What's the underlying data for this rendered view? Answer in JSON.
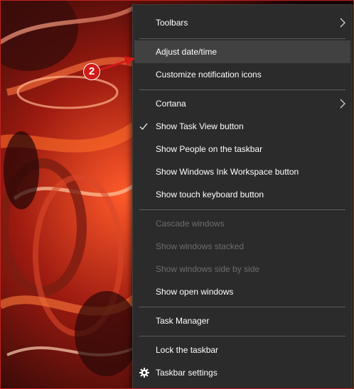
{
  "callout": {
    "number": "2"
  },
  "menu": {
    "toolbars": "Toolbars",
    "adjust_datetime": "Adjust date/time",
    "customize_notifications": "Customize notification icons",
    "cortana": "Cortana",
    "show_task_view": "Show Task View button",
    "show_task_view_checked": true,
    "show_people": "Show People on the taskbar",
    "show_ink": "Show Windows Ink Workspace button",
    "show_touch_keyboard": "Show touch keyboard button",
    "cascade": "Cascade windows",
    "stacked": "Show windows stacked",
    "side_by_side": "Show windows side by side",
    "show_open_windows": "Show open windows",
    "task_manager": "Task Manager",
    "lock_taskbar": "Lock the taskbar",
    "taskbar_settings": "Taskbar settings"
  },
  "colors": {
    "menu_bg": "#2b2b2b",
    "hover_bg": "#414141",
    "disabled_text": "#6d6d6d",
    "accent_red": "#d11b17"
  }
}
